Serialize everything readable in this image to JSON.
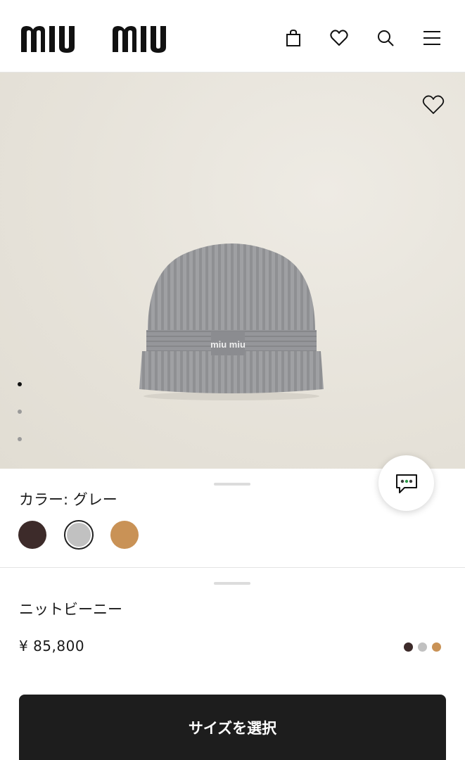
{
  "header": {
    "brand": "miu miu",
    "icons": [
      "bag-icon",
      "heart-icon",
      "search-icon",
      "menu-icon"
    ]
  },
  "gallery": {
    "image": "beanie-photo",
    "slide_count": 3,
    "active_slide": 1
  },
  "colors": {
    "label": "カラー:  グレー",
    "swatches": [
      {
        "name": "brown",
        "hex": "#3d2b2a",
        "selected": false
      },
      {
        "name": "grey",
        "hex": "#c1c1c1",
        "selected": true
      },
      {
        "name": "camel",
        "hex": "#c99256",
        "selected": false
      }
    ]
  },
  "product": {
    "name": "ニットビーニー",
    "price": "¥ 85,800",
    "available_colors": [
      "#3d2b2a",
      "#c1c1c1",
      "#c99256"
    ]
  },
  "cta": {
    "label": "サイズを選択"
  }
}
